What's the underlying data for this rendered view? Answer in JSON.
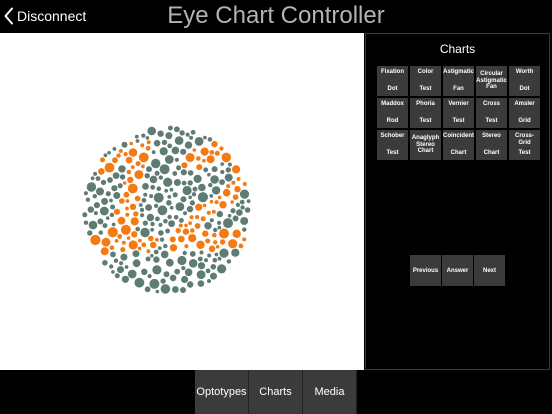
{
  "header": {
    "back_label": "Disconnect",
    "title": "Eye Chart Controller"
  },
  "plate": {
    "number": "12",
    "dot_color": "#5e7b74",
    "figure_color": "#f47a13",
    "background": "#ffffff"
  },
  "panel": {
    "title": "Charts",
    "buttons": [
      {
        "top": "Fixation",
        "bottom": "Dot"
      },
      {
        "top": "Color",
        "bottom": "Test"
      },
      {
        "top": "Astigmatic",
        "bottom": "Fan"
      },
      {
        "top": "Circular\nAstigmatic\nFan",
        "bottom": ""
      },
      {
        "top": "Worth",
        "bottom": "Dot"
      },
      {
        "top": "Maddox",
        "bottom": "Rod"
      },
      {
        "top": "Phoria",
        "bottom": "Test"
      },
      {
        "top": "Vernier",
        "bottom": "Test"
      },
      {
        "top": "Cross",
        "bottom": "Test"
      },
      {
        "top": "Amsler",
        "bottom": "Grid"
      },
      {
        "top": "Schober",
        "bottom": "Test"
      },
      {
        "top": "Anaglyph\nStereo\nChart",
        "bottom": ""
      },
      {
        "top": "Coincident",
        "bottom": "Chart"
      },
      {
        "top": "Stereo",
        "bottom": "Chart"
      },
      {
        "top": "Cross-Grid",
        "bottom": "Test"
      }
    ],
    "nav": {
      "previous": "Previous",
      "answer": "Answer",
      "next": "Next"
    }
  },
  "tabs": {
    "optotypes": "Optotypes",
    "charts": "Charts",
    "media": "Media"
  }
}
